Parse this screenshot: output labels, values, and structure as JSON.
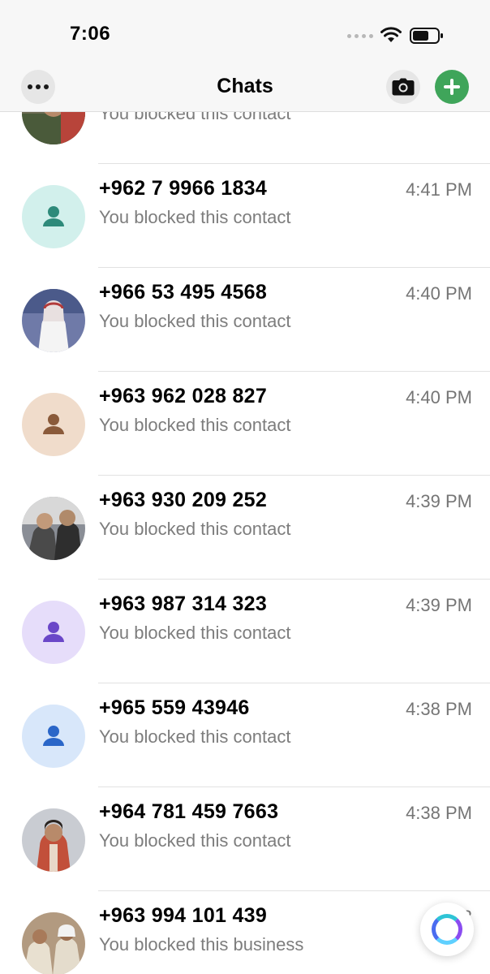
{
  "status_bar": {
    "time": "7:06"
  },
  "header": {
    "title": "Chats"
  },
  "partial_top": {
    "preview": "You blocked this contact"
  },
  "chats": [
    {
      "name": "+962 7 9966 1834",
      "time": "4:41 PM",
      "preview": "You blocked this contact",
      "avatar": "default",
      "avatar_bg": "#d2f0ec",
      "avatar_fg": "#2e8a7a"
    },
    {
      "name": "+966 53 495 4568",
      "time": "4:40 PM",
      "preview": "You blocked this contact",
      "avatar": "photo",
      "avatar_bg": "#6f7aa8"
    },
    {
      "name": "+963 962 028 827",
      "time": "4:40 PM",
      "preview": "You blocked this contact",
      "avatar": "default",
      "avatar_bg": "#f0dccb",
      "avatar_fg": "#8a5a3a"
    },
    {
      "name": "+963 930 209 252",
      "time": "4:39 PM",
      "preview": "You blocked this contact",
      "avatar": "photo",
      "avatar_bg": "#8a8e96"
    },
    {
      "name": "+963 987 314 323",
      "time": "4:39 PM",
      "preview": "You blocked this contact",
      "avatar": "default",
      "avatar_bg": "#e6ddfa",
      "avatar_fg": "#6a47c8"
    },
    {
      "name": "+965 559 43946",
      "time": "4:38 PM",
      "preview": "You blocked this contact",
      "avatar": "default",
      "avatar_bg": "#d8e7fa",
      "avatar_fg": "#2a66c8"
    },
    {
      "name": "+964 781 459 7663",
      "time": "4:38 PM",
      "preview": "You blocked this contact",
      "avatar": "photo",
      "avatar_bg": "#c9ccd2"
    },
    {
      "name": "+963 994 101 439",
      "time": "4:3",
      "preview": "You blocked this business",
      "avatar": "photo",
      "avatar_bg": "#b29a80"
    }
  ],
  "colors": {
    "accent_green": "#3fa55a",
    "secondary_text": "#7d7d7d"
  },
  "icons": {
    "menu": "more-icon",
    "camera": "camera-icon",
    "new_chat": "plus-icon",
    "assistant": "meta-ai-icon"
  }
}
